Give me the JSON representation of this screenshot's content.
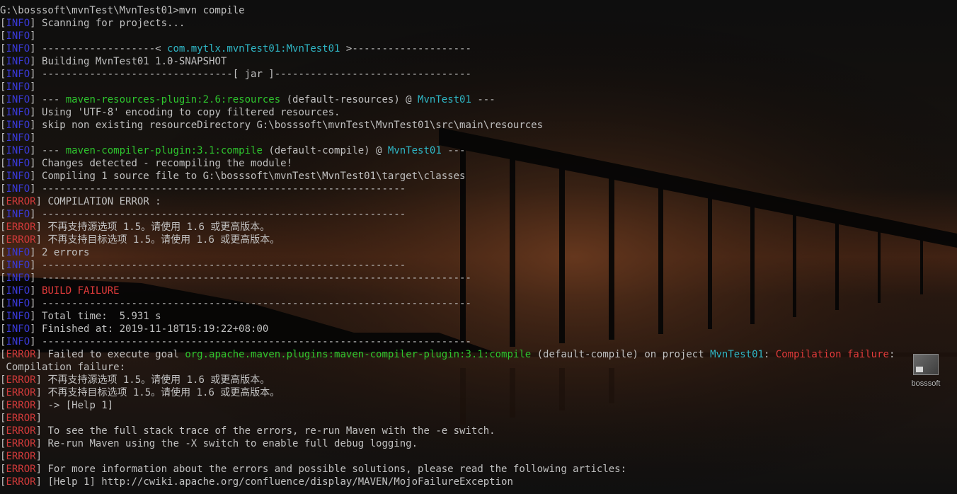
{
  "terminal": {
    "lines": [
      [
        {
          "t": "G:\\bosssoft\\mvnTest\\MvnTest01>mvn compile",
          "c": "default"
        }
      ],
      [
        {
          "t": "[",
          "c": "bracket"
        },
        {
          "t": "INFO",
          "c": "info"
        },
        {
          "t": "] ",
          "c": "bracket"
        },
        {
          "t": "Scanning for projects...",
          "c": "default"
        }
      ],
      [
        {
          "t": "[",
          "c": "bracket"
        },
        {
          "t": "INFO",
          "c": "info"
        },
        {
          "t": "]",
          "c": "bracket"
        }
      ],
      [
        {
          "t": "[",
          "c": "bracket"
        },
        {
          "t": "INFO",
          "c": "info"
        },
        {
          "t": "] ",
          "c": "bracket"
        },
        {
          "t": "-------------------< ",
          "c": "default"
        },
        {
          "t": "com.mytlx.mvnTest01:MvnTest01",
          "c": "cyan"
        },
        {
          "t": " >--------------------",
          "c": "default"
        }
      ],
      [
        {
          "t": "[",
          "c": "bracket"
        },
        {
          "t": "INFO",
          "c": "info"
        },
        {
          "t": "] ",
          "c": "bracket"
        },
        {
          "t": "Building MvnTest01 1.0-SNAPSHOT",
          "c": "default"
        }
      ],
      [
        {
          "t": "[",
          "c": "bracket"
        },
        {
          "t": "INFO",
          "c": "info"
        },
        {
          "t": "] ",
          "c": "bracket"
        },
        {
          "t": "--------------------------------[ jar ]---------------------------------",
          "c": "default"
        }
      ],
      [
        {
          "t": "[",
          "c": "bracket"
        },
        {
          "t": "INFO",
          "c": "info"
        },
        {
          "t": "]",
          "c": "bracket"
        }
      ],
      [
        {
          "t": "[",
          "c": "bracket"
        },
        {
          "t": "INFO",
          "c": "info"
        },
        {
          "t": "] ",
          "c": "bracket"
        },
        {
          "t": "--- ",
          "c": "default"
        },
        {
          "t": "maven-resources-plugin:2.6:resources",
          "c": "green"
        },
        {
          "t": " (default-resources) @ ",
          "c": "default"
        },
        {
          "t": "MvnTest01",
          "c": "cyan"
        },
        {
          "t": " ---",
          "c": "default"
        }
      ],
      [
        {
          "t": "[",
          "c": "bracket"
        },
        {
          "t": "INFO",
          "c": "info"
        },
        {
          "t": "] ",
          "c": "bracket"
        },
        {
          "t": "Using 'UTF-8' encoding to copy filtered resources.",
          "c": "default"
        }
      ],
      [
        {
          "t": "[",
          "c": "bracket"
        },
        {
          "t": "INFO",
          "c": "info"
        },
        {
          "t": "] ",
          "c": "bracket"
        },
        {
          "t": "skip non existing resourceDirectory G:\\bosssoft\\mvnTest\\MvnTest01\\src\\main\\resources",
          "c": "default"
        }
      ],
      [
        {
          "t": "[",
          "c": "bracket"
        },
        {
          "t": "INFO",
          "c": "info"
        },
        {
          "t": "]",
          "c": "bracket"
        }
      ],
      [
        {
          "t": "[",
          "c": "bracket"
        },
        {
          "t": "INFO",
          "c": "info"
        },
        {
          "t": "] ",
          "c": "bracket"
        },
        {
          "t": "--- ",
          "c": "default"
        },
        {
          "t": "maven-compiler-plugin:3.1:compile",
          "c": "green"
        },
        {
          "t": " (default-compile) @ ",
          "c": "default"
        },
        {
          "t": "MvnTest01",
          "c": "cyan"
        },
        {
          "t": " ---",
          "c": "default"
        }
      ],
      [
        {
          "t": "[",
          "c": "bracket"
        },
        {
          "t": "INFO",
          "c": "info"
        },
        {
          "t": "] ",
          "c": "bracket"
        },
        {
          "t": "Changes detected - recompiling the module!",
          "c": "default"
        }
      ],
      [
        {
          "t": "[",
          "c": "bracket"
        },
        {
          "t": "INFO",
          "c": "info"
        },
        {
          "t": "] ",
          "c": "bracket"
        },
        {
          "t": "Compiling 1 source file to G:\\bosssoft\\mvnTest\\MvnTest01\\target\\classes",
          "c": "default"
        }
      ],
      [
        {
          "t": "[",
          "c": "bracket"
        },
        {
          "t": "INFO",
          "c": "info"
        },
        {
          "t": "] ",
          "c": "bracket"
        },
        {
          "t": "-------------------------------------------------------------",
          "c": "default"
        }
      ],
      [
        {
          "t": "[",
          "c": "bracket"
        },
        {
          "t": "ERROR",
          "c": "error"
        },
        {
          "t": "] ",
          "c": "bracket"
        },
        {
          "t": "COMPILATION ERROR :",
          "c": "default"
        }
      ],
      [
        {
          "t": "[",
          "c": "bracket"
        },
        {
          "t": "INFO",
          "c": "info"
        },
        {
          "t": "] ",
          "c": "bracket"
        },
        {
          "t": "-------------------------------------------------------------",
          "c": "default"
        }
      ],
      [
        {
          "t": "[",
          "c": "bracket"
        },
        {
          "t": "ERROR",
          "c": "error"
        },
        {
          "t": "] ",
          "c": "bracket"
        },
        {
          "t": "不再支持源选项 1.5。请使用 1.6 或更高版本。",
          "c": "default"
        }
      ],
      [
        {
          "t": "[",
          "c": "bracket"
        },
        {
          "t": "ERROR",
          "c": "error"
        },
        {
          "t": "] ",
          "c": "bracket"
        },
        {
          "t": "不再支持目标选项 1.5。请使用 1.6 或更高版本。",
          "c": "default"
        }
      ],
      [
        {
          "t": "[",
          "c": "bracket"
        },
        {
          "t": "INFO",
          "c": "info"
        },
        {
          "t": "] ",
          "c": "bracket"
        },
        {
          "t": "2 errors",
          "c": "default"
        }
      ],
      [
        {
          "t": "[",
          "c": "bracket"
        },
        {
          "t": "INFO",
          "c": "info"
        },
        {
          "t": "] ",
          "c": "bracket"
        },
        {
          "t": "-------------------------------------------------------------",
          "c": "default"
        }
      ],
      [
        {
          "t": "[",
          "c": "bracket"
        },
        {
          "t": "INFO",
          "c": "info"
        },
        {
          "t": "] ",
          "c": "bracket"
        },
        {
          "t": "------------------------------------------------------------------------",
          "c": "default"
        }
      ],
      [
        {
          "t": "[",
          "c": "bracket"
        },
        {
          "t": "INFO",
          "c": "info"
        },
        {
          "t": "] ",
          "c": "bracket"
        },
        {
          "t": "BUILD FAILURE",
          "c": "red"
        }
      ],
      [
        {
          "t": "[",
          "c": "bracket"
        },
        {
          "t": "INFO",
          "c": "info"
        },
        {
          "t": "] ",
          "c": "bracket"
        },
        {
          "t": "------------------------------------------------------------------------",
          "c": "default"
        }
      ],
      [
        {
          "t": "[",
          "c": "bracket"
        },
        {
          "t": "INFO",
          "c": "info"
        },
        {
          "t": "] ",
          "c": "bracket"
        },
        {
          "t": "Total time:  5.931 s",
          "c": "default"
        }
      ],
      [
        {
          "t": "[",
          "c": "bracket"
        },
        {
          "t": "INFO",
          "c": "info"
        },
        {
          "t": "] ",
          "c": "bracket"
        },
        {
          "t": "Finished at: 2019-11-18T15:19:22+08:00",
          "c": "default"
        }
      ],
      [
        {
          "t": "[",
          "c": "bracket"
        },
        {
          "t": "INFO",
          "c": "info"
        },
        {
          "t": "] ",
          "c": "bracket"
        },
        {
          "t": "------------------------------------------------------------------------",
          "c": "default"
        }
      ],
      [
        {
          "t": "[",
          "c": "bracket"
        },
        {
          "t": "ERROR",
          "c": "error"
        },
        {
          "t": "] ",
          "c": "bracket"
        },
        {
          "t": "Failed to execute goal ",
          "c": "default"
        },
        {
          "t": "org.apache.maven.plugins:maven-compiler-plugin:3.1:compile",
          "c": "green"
        },
        {
          "t": " (default-compile) on project ",
          "c": "default"
        },
        {
          "t": "MvnTest01",
          "c": "cyan"
        },
        {
          "t": ": ",
          "c": "default"
        },
        {
          "t": "Compilation failure",
          "c": "red"
        },
        {
          "t": ":",
          "c": "default"
        }
      ],
      [
        {
          "t": " Compilation failure:",
          "c": "default"
        }
      ],
      [
        {
          "t": "[",
          "c": "bracket"
        },
        {
          "t": "ERROR",
          "c": "error"
        },
        {
          "t": "] ",
          "c": "bracket"
        },
        {
          "t": "不再支持源选项 1.5。请使用 1.6 或更高版本。",
          "c": "default"
        }
      ],
      [
        {
          "t": "[",
          "c": "bracket"
        },
        {
          "t": "ERROR",
          "c": "error"
        },
        {
          "t": "] ",
          "c": "bracket"
        },
        {
          "t": "不再支持目标选项 1.5。请使用 1.6 或更高版本。",
          "c": "default"
        }
      ],
      [
        {
          "t": "[",
          "c": "bracket"
        },
        {
          "t": "ERROR",
          "c": "error"
        },
        {
          "t": "] ",
          "c": "bracket"
        },
        {
          "t": "-> [Help 1]",
          "c": "default"
        }
      ],
      [
        {
          "t": "[",
          "c": "bracket"
        },
        {
          "t": "ERROR",
          "c": "error"
        },
        {
          "t": "]",
          "c": "bracket"
        }
      ],
      [
        {
          "t": "[",
          "c": "bracket"
        },
        {
          "t": "ERROR",
          "c": "error"
        },
        {
          "t": "] ",
          "c": "bracket"
        },
        {
          "t": "To see the full stack trace of the errors, re-run Maven with the -e switch.",
          "c": "default"
        }
      ],
      [
        {
          "t": "[",
          "c": "bracket"
        },
        {
          "t": "ERROR",
          "c": "error"
        },
        {
          "t": "] ",
          "c": "bracket"
        },
        {
          "t": "Re-run Maven using the -X switch to enable full debug logging.",
          "c": "default"
        }
      ],
      [
        {
          "t": "[",
          "c": "bracket"
        },
        {
          "t": "ERROR",
          "c": "error"
        },
        {
          "t": "]",
          "c": "bracket"
        }
      ],
      [
        {
          "t": "[",
          "c": "bracket"
        },
        {
          "t": "ERROR",
          "c": "error"
        },
        {
          "t": "] ",
          "c": "bracket"
        },
        {
          "t": "For more information about the errors and possible solutions, please read the following articles:",
          "c": "default"
        }
      ],
      [
        {
          "t": "[",
          "c": "bracket"
        },
        {
          "t": "ERROR",
          "c": "error"
        },
        {
          "t": "] ",
          "c": "bracket"
        },
        {
          "t": "[Help 1] http://cwiki.apache.org/confluence/display/MAVEN/MojoFailureException",
          "c": "default"
        }
      ]
    ]
  },
  "desktop_icon": {
    "label": "bosssoft",
    "icon": "folder-shortcut-icon"
  },
  "colors": {
    "background": "#0c0c0c",
    "text": "#c0c0c0",
    "info": "#3a3ad8",
    "error": "#d23a3a",
    "green": "#2ec52e",
    "cyan": "#2fb7c6",
    "red": "#e23b3b"
  }
}
